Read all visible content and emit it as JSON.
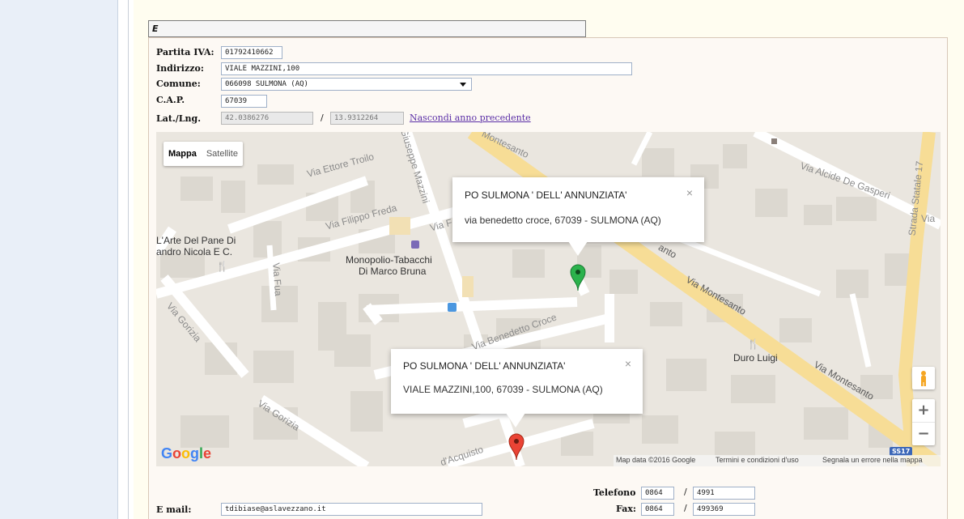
{
  "section": {
    "header": "E"
  },
  "form": {
    "partita_iva": {
      "label": "Partita IVA:",
      "value": "01792410662"
    },
    "indirizzo": {
      "label": "Indirizzo:",
      "value": "VIALE MAZZINI,100"
    },
    "comune": {
      "label": "Comune:",
      "value": "066098 SULMONA (AQ)"
    },
    "cap": {
      "label": "C.A.P.",
      "value": "67039"
    },
    "latlng": {
      "label": "Lat./Lng.",
      "lat": "42.0386276",
      "sep": "/",
      "lng": "13.9312264",
      "link": "Nascondi anno precedente"
    },
    "email": {
      "label": "E mail:",
      "value": "tdibiase@aslavezzano.it"
    },
    "telefono": {
      "label": "Telefono",
      "prefix": "0864",
      "sep": "/",
      "number": "4991"
    },
    "fax": {
      "label": "Fax:",
      "prefix": "0864",
      "sep": "/",
      "number": "499369"
    }
  },
  "map": {
    "toggle": {
      "map": "Mappa",
      "satellite": "Satellite"
    },
    "labels": {
      "montesanto_top": "Montesanto",
      "via_ettore_troilo": "Via Ettore Troilo",
      "giuseppe_mazzini": "Giuseppe Mazzini",
      "via_alcide": "Via Alcide De Gasperi",
      "via_edge": "Via",
      "strada_statale": "Strada Statale 17",
      "via_filippo_freda": "Via Filippo Freda",
      "via_f_short": "Via F",
      "arte_pane_1": "L'Arte Del Pane Di",
      "arte_pane_2": "andro Nicola E C.",
      "monopolio_1": "Monopolio-Tabacchi",
      "monopolio_2": "Di Marco Bruna",
      "via_fua": "Via Fua",
      "via_gorizia_1": "Via Gorizia",
      "via_gorizia_2": "Via Gorizia",
      "via_benedetto_croce": "Via Benedetto Croce",
      "via_montesanto_1": "Via Montesanto",
      "via_montesanto_2": "Via Montesanto",
      "montesanto_mid": "anto",
      "duro_luigi": "Duro Luigi",
      "acquisto": "d'Acquisto",
      "ss17": "SS17"
    },
    "popup1": {
      "title": "PO SULMONA ' DELL' ANNUNZIATA'",
      "address": "via benedetto croce, 67039 - SULMONA (AQ)",
      "close": "×"
    },
    "popup2": {
      "title": "PO SULMONA ' DELL' ANNUNZIATA'",
      "address": "VIALE MAZZINI,100, 67039 - SULMONA (AQ)",
      "close": "×"
    },
    "zoom_in": "+",
    "zoom_out": "−",
    "logo": "Google",
    "footer": {
      "data": "Map data ©2016 Google",
      "terms": "Termini e condizioni d'uso",
      "report": "Segnala un errore nella mappa"
    },
    "colors": {
      "land": "#eae6df",
      "road": "#ffffff",
      "arterial": "#f7dd96",
      "building": "#dcd8d0",
      "marker_green": "#2bb24c",
      "marker_red": "#ea4335"
    }
  }
}
